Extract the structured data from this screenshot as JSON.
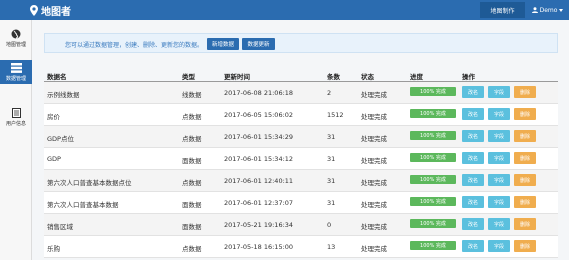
{
  "app": {
    "title": "地图者"
  },
  "topbar": {
    "nav_label": "地图制作",
    "user_label": "Demo"
  },
  "sidebar": {
    "items": [
      {
        "label": "地图管理",
        "icon": "globe-icon"
      },
      {
        "label": "数据管理",
        "icon": "server-icon",
        "active": true
      },
      {
        "label": "用户信息",
        "icon": "document-icon"
      }
    ]
  },
  "info": {
    "text": "您可以通过数据管理，创建、删除、更新您的数据。",
    "new_button": "新增数据",
    "update_button": "数据更新"
  },
  "table": {
    "headers": [
      "数据名",
      "类型",
      "更新时间",
      "条数",
      "状态",
      "进度",
      "操作"
    ],
    "progress_label": "100% 完成",
    "actions": {
      "rename": "改名",
      "field": "字段",
      "delete": "删除"
    },
    "rows": [
      {
        "name": "示例线数据",
        "type": "线数据",
        "time": "2017-06-08 21:06:18",
        "count": "2",
        "status": "处理完成",
        "progress": 1.0
      },
      {
        "name": "房价",
        "type": "点数据",
        "time": "2017-06-05 15:06:02",
        "count": "1512",
        "status": "处理完成",
        "progress": 1.0
      },
      {
        "name": "GDP点位",
        "type": "点数据",
        "time": "2017-06-01 15:34:29",
        "count": "31",
        "status": "处理完成",
        "progress": 1.0
      },
      {
        "name": "GDP",
        "type": "面数据",
        "time": "2017-06-01 15:34:12",
        "count": "31",
        "status": "处理完成",
        "progress": 1.0
      },
      {
        "name": "第六次人口普查基本数据点位",
        "type": "点数据",
        "time": "2017-06-01 12:40:11",
        "count": "31",
        "status": "处理完成",
        "progress": 1.0
      },
      {
        "name": "第六次人口普查基本数据",
        "type": "面数据",
        "time": "2017-06-01 12:37:07",
        "count": "31",
        "status": "处理完成",
        "progress": 1.0
      },
      {
        "name": "销售区域",
        "type": "面数据",
        "time": "2017-05-21 19:16:34",
        "count": "0",
        "status": "处理完成",
        "progress": 1.0
      },
      {
        "name": "乐购",
        "type": "点数据",
        "time": "2017-05-18 16:15:00",
        "count": "13",
        "status": "处理完成",
        "progress": 1.0
      }
    ]
  },
  "colors": {
    "primary": "#2b6cb0",
    "info_bg": "#e8f2fb",
    "success": "#5cb85c",
    "info_btn": "#5bc0de",
    "warning": "#f0ad4e"
  }
}
